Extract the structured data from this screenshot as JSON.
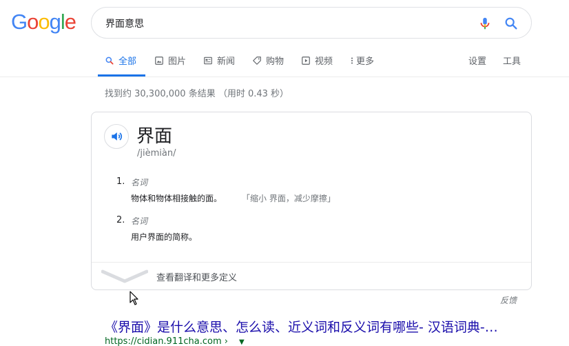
{
  "logo": {
    "letters": [
      "G",
      "o",
      "o",
      "g",
      "l",
      "e"
    ],
    "colors": [
      "#4285F4",
      "#EA4335",
      "#FBBC05",
      "#4285F4",
      "#34A853",
      "#EA4335"
    ]
  },
  "search": {
    "query": "界面意思"
  },
  "tabs": [
    {
      "label": "全部",
      "icon": "search-icon",
      "active": true
    },
    {
      "label": "图片",
      "icon": "image-icon"
    },
    {
      "label": "新闻",
      "icon": "news-icon"
    },
    {
      "label": "购物",
      "icon": "tag-icon"
    },
    {
      "label": "视频",
      "icon": "play-icon"
    },
    {
      "label": "更多",
      "icon": "more-vert-icon"
    }
  ],
  "right_tabs": {
    "settings": "设置",
    "tools": "工具"
  },
  "result_stats": "找到约 30,300,000 条结果 （用时 0.43 秒）",
  "dictionary": {
    "headword": "界面",
    "phonetic": "/jièmiàn/",
    "senses": [
      {
        "num": "1.",
        "pos": "名词",
        "definition": "物体和物体相接触的面。",
        "example": "「缩小 界面，减少摩擦」"
      },
      {
        "num": "2.",
        "pos": "名词",
        "definition": "用户界面的简称。",
        "example": ""
      }
    ],
    "expand_label": "查看翻译和更多定义"
  },
  "feedback": "反馈",
  "result": {
    "title": "《界面》是什么意思、怎么读、近义词和反义词有哪些- 汉语词典-…",
    "url": "https://cidian.911cha.com ›"
  },
  "colors": {
    "accent": "#1a73e8",
    "link": "#1a0dab",
    "url_green": "#006621"
  }
}
